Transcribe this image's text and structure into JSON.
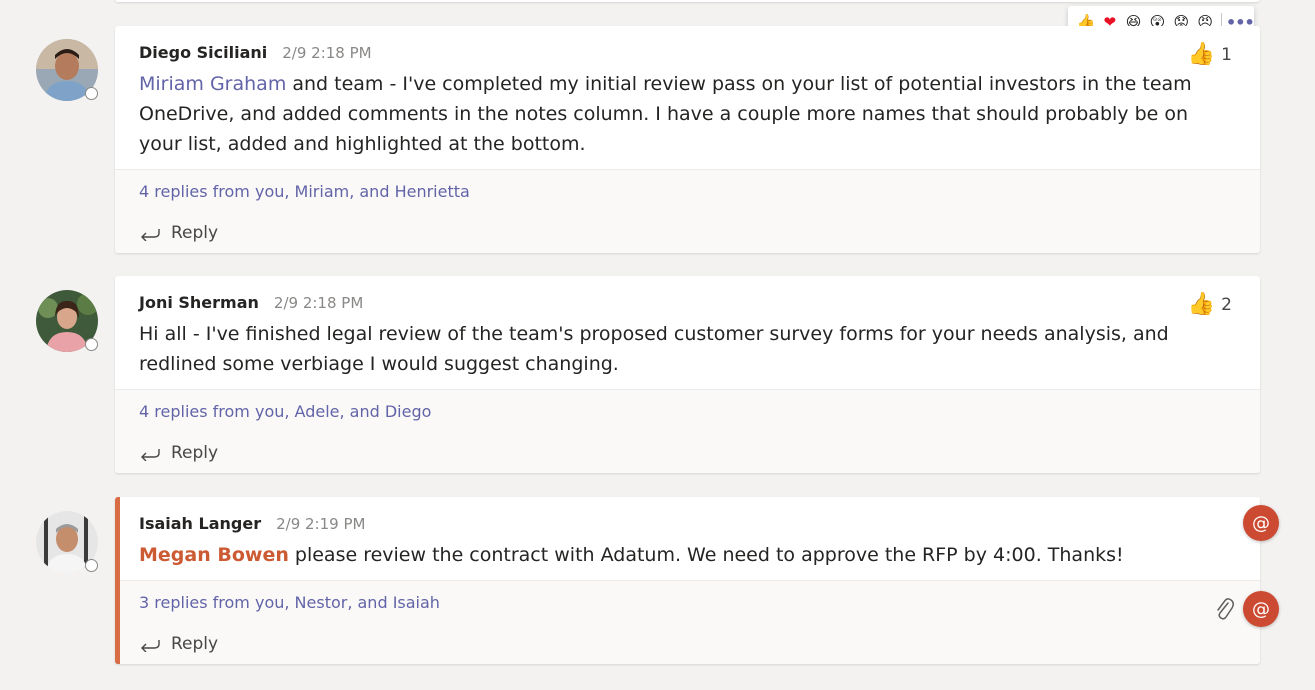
{
  "threads": [
    {
      "author": "Diego Siciliani",
      "time": "2/9 2:18 PM",
      "mention": "Miriam Graham",
      "text": " and team - I've completed my initial review pass on your list of potential investors in the team OneDrive, and added comments in the notes column. I have a couple more names that should probably be on your list, added and highlighted at the bottom.",
      "like_count": "1",
      "replies": "4 replies from you, Miriam, and Henrietta",
      "reply_label": "Reply"
    },
    {
      "author": "Joni Sherman",
      "time": "2/9 2:18 PM",
      "text": "Hi all - I've finished legal review of the team's proposed customer survey forms for your needs analysis, and redlined some verbiage I would suggest changing.",
      "like_count": "2",
      "replies": "4 replies from you, Adele, and Diego",
      "reply_label": "Reply"
    },
    {
      "author": "Isaiah Langer",
      "time": "2/9 2:19 PM",
      "mention": "Megan Bowen",
      "text": " please review the contract with Adatum. We need to approve the RFP by 4:00. Thanks!",
      "replies": "3 replies from you, Nestor, and Isaiah",
      "reply_label": "Reply"
    }
  ],
  "reactions": [
    "like",
    "heart",
    "laugh",
    "surprised",
    "sad",
    "angry"
  ],
  "icons": {
    "like": "thumbs-up-icon",
    "reply": "reply-arrow-icon",
    "at": "at-mention-icon",
    "attachment": "paperclip-icon",
    "more": "more-options-icon"
  },
  "colors": {
    "accent": "#6264a7",
    "mention_highlight": "#cc5a32",
    "mention_badge": "#cc4a31",
    "background": "#f3f2f1"
  }
}
